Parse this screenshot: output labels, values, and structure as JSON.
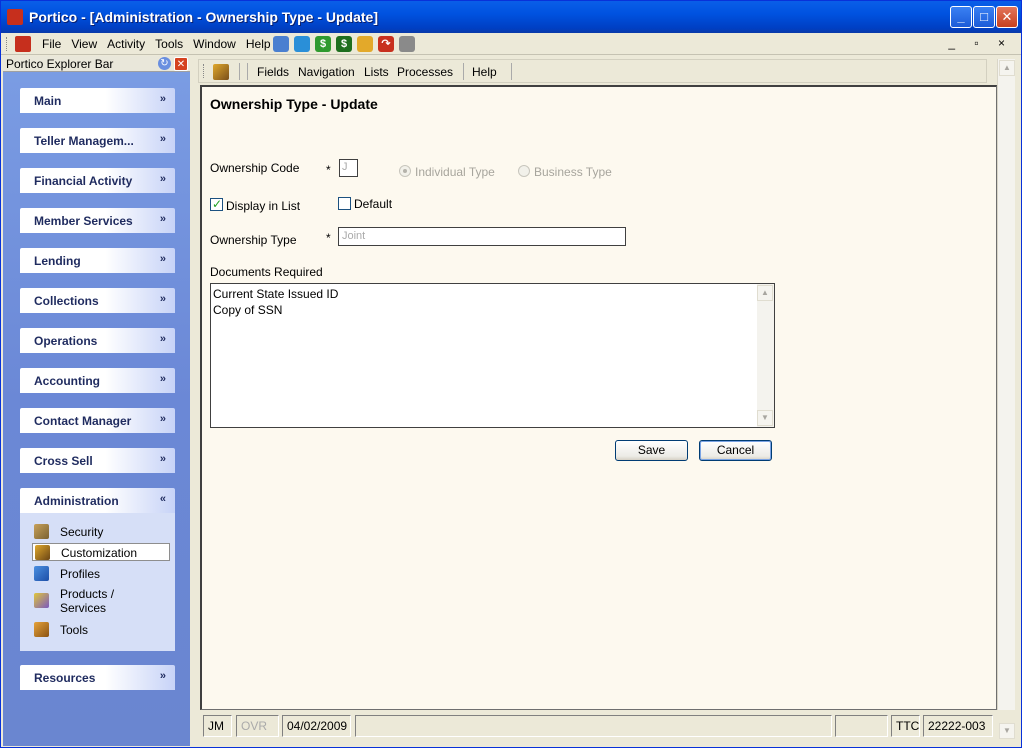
{
  "window": {
    "title": "Portico - [Administration - Ownership Type - Update]",
    "app_icon": "portico-logo-icon",
    "controls": {
      "minimize": "_",
      "maximize": "□",
      "close": "✕"
    }
  },
  "menubar": {
    "items": [
      "File",
      "View",
      "Activity",
      "Tools",
      "Window",
      "Help"
    ],
    "toolbar_icons": [
      "network-icon",
      "tag-icon",
      "dollar-icon",
      "cash-drawer-icon",
      "coin-bag-icon",
      "redo-arrow-icon",
      "printer-icon"
    ],
    "mdi_controls": "_ ▫ ×"
  },
  "explorer": {
    "title": "Portico Explorer Bar",
    "groups": [
      {
        "label": "Main",
        "chevron": "»"
      },
      {
        "label": "Teller Managem...",
        "chevron": "»"
      },
      {
        "label": "Financial Activity",
        "chevron": "»"
      },
      {
        "label": "Member Services",
        "chevron": "»"
      },
      {
        "label": "Lending",
        "chevron": "»"
      },
      {
        "label": "Collections",
        "chevron": "»"
      },
      {
        "label": "Operations",
        "chevron": "»"
      },
      {
        "label": "Accounting",
        "chevron": "»"
      },
      {
        "label": "Contact Manager",
        "chevron": "»"
      },
      {
        "label": "Cross Sell",
        "chevron": "»"
      },
      {
        "label": "Administration",
        "chevron": "«"
      },
      {
        "label": "Resources",
        "chevron": "»"
      }
    ],
    "admin_items": [
      {
        "label": "Security",
        "icon": "keys-icon"
      },
      {
        "label": "Customization",
        "icon": "customization-icon",
        "selected": true
      },
      {
        "label": "Profiles",
        "icon": "profiles-icon"
      },
      {
        "label": "Products /",
        "label2": "Services",
        "icon": "products-icon"
      },
      {
        "label": "Tools",
        "icon": "toolbox-icon"
      }
    ]
  },
  "cmdbar": {
    "items": [
      "Fields",
      "Navigation",
      "Lists",
      "Processes",
      "Help"
    ]
  },
  "form": {
    "title": "Ownership Type - Update",
    "ownership_code_label": "Ownership Code",
    "ownership_code_value": "J",
    "required_marker": "*",
    "radio_individual": "Individual Type",
    "radio_business": "Business Type",
    "display_in_list_label": "Display in List",
    "display_in_list_checked": true,
    "default_label": "Default",
    "default_checked": false,
    "ownership_type_label": "Ownership Type",
    "ownership_type_value": "Joint",
    "documents_label": "Documents Required",
    "documents": [
      "Current State Issued ID",
      "Copy of SSN"
    ],
    "save_label": "Save",
    "cancel_label": "Cancel"
  },
  "statusbar": {
    "user": "JM",
    "ovr": "OVR",
    "date": "04/02/2009",
    "ttc": "TTC",
    "code": "22222-003"
  }
}
